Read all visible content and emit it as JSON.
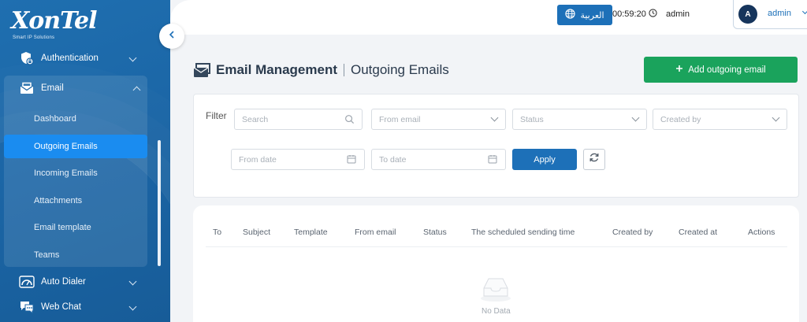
{
  "brand": {
    "logo": "XonTel",
    "tagline": "Smart IP Solutions"
  },
  "sidebar": {
    "items_top": [
      {
        "label": "Authentication",
        "icon": "shield-icon"
      }
    ],
    "email": {
      "label": "Email",
      "icon": "email-icon",
      "sub_items": [
        {
          "label": "Dashboard",
          "active": false
        },
        {
          "label": "Outgoing Emails",
          "active": true
        },
        {
          "label": "Incoming Emails",
          "active": false
        },
        {
          "label": "Attachments",
          "active": false
        },
        {
          "label": "Email template",
          "active": false
        },
        {
          "label": "Teams",
          "active": false
        }
      ]
    },
    "items_bottom": [
      {
        "label": "Auto Dialer",
        "icon": "gauge-icon"
      },
      {
        "label": "Web Chat",
        "icon": "chat-icon"
      }
    ]
  },
  "header": {
    "language_label": "العربية",
    "timer": "00:59:20",
    "admin_label": "admin",
    "user": {
      "initial": "A",
      "name": "admin"
    }
  },
  "page": {
    "title": "Email Management",
    "subtitle": "Outgoing Emails",
    "add_button": "Add outgoing email"
  },
  "filter": {
    "label": "Filter",
    "search_placeholder": "Search",
    "from_email_placeholder": "From email",
    "status_placeholder": "Status",
    "created_by_placeholder": "Created by",
    "from_date_placeholder": "From date",
    "to_date_placeholder": "To date",
    "apply_label": "Apply"
  },
  "table": {
    "columns": [
      "To",
      "Subject",
      "Template",
      "From email",
      "Status",
      "The scheduled sending time",
      "Created by",
      "Created at",
      "Actions"
    ],
    "empty_text": "No Data"
  },
  "colors": {
    "sidebar": "#1b65a5",
    "primary": "#1d70b8",
    "active_item": "#1a8cf0",
    "success": "#1aa35c"
  }
}
